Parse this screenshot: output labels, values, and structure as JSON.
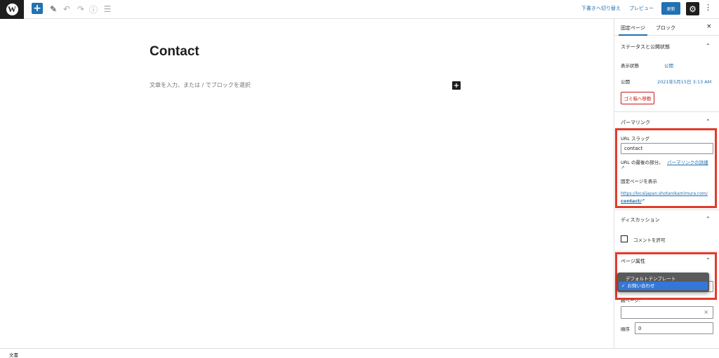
{
  "toolbar": {
    "logo": "W",
    "add_icon": "+",
    "edit_icon": "✎",
    "undo_icon": "↶",
    "redo_icon": "↷",
    "info_icon": "ⓘ",
    "list_icon": "☰",
    "switch_draft": "下書きへ切り替え",
    "preview": "プレビュー",
    "update": "更新",
    "settings_icon": "⚙",
    "more_icon": "⋮"
  },
  "editor": {
    "title": "Contact",
    "placeholder": "文章を入力、または / でブロックを選択",
    "inserter_icon": "+"
  },
  "footer": {
    "breadcrumb": "文書"
  },
  "sidebar": {
    "tabs": [
      "固定ページ",
      "ブロック"
    ],
    "close_icon": "×",
    "status": {
      "title": "ステータスと公開状態",
      "visibility_label": "表示状態",
      "visibility_value": "公開",
      "publish_label": "公開",
      "publish_value": "2021年5月15日 3:13 AM",
      "trash_button": "ゴミ箱へ移動"
    },
    "permalink": {
      "title": "パーマリンク",
      "slug_label": "URL スラッグ",
      "slug_value": "contact",
      "help_text": "URL の最後の部分。",
      "help_link": "パーマリンクの詳細",
      "view_label": "固定ページを表示",
      "url_line1": "https://localjapan.shotarokamimura.com/",
      "url_line2": "contact/"
    },
    "discussion": {
      "title": "ディスカッション",
      "allow_comments": "コメントを許可"
    },
    "page_attributes": {
      "title": "ページ属性",
      "template_options": [
        "デフォルトテンプレート",
        "お問い合わせ"
      ],
      "selected_template": "お問い合わせ",
      "parent_label": "親ページ:",
      "order_label": "順序",
      "order_value": "0"
    },
    "chevron_icon": "⌃",
    "external_icon": "↗"
  },
  "colors": {
    "accent": "#2271b1",
    "highlight": "#e23a2a",
    "danger": "#cc1818"
  }
}
